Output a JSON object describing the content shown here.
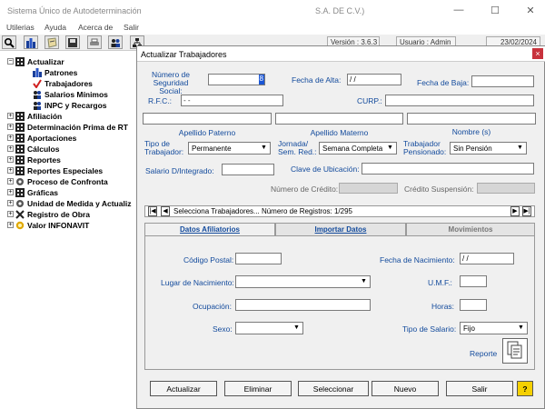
{
  "window": {
    "title": "Sistema Único de Autodeterminación",
    "title_suffix": "S.A. DE C.V.)",
    "minimize_glyph": "—",
    "maximize_glyph": "☐",
    "close_glyph": "✕"
  },
  "menu": [
    "Utilerias",
    "Ayuda",
    "Acerca de",
    "Salir"
  ],
  "status": {
    "version": "Versión : 3.6.3",
    "user": "Usuario : Admin",
    "date": "23/02/2024"
  },
  "toolbar_icons": [
    "search-icon",
    "buildings-icon",
    "document-icon",
    "save-icon",
    "printer-icon",
    "users-icon",
    "network-icon"
  ],
  "tree": [
    {
      "label": "Actualizar",
      "expander": "−",
      "level": 0
    },
    {
      "label": "Patrones",
      "level": 1
    },
    {
      "label": "Trabajadores",
      "level": 1
    },
    {
      "label": "Salarios Mínimos",
      "level": 1
    },
    {
      "label": "INPC y Recargos",
      "level": 1
    },
    {
      "label": "Afiliación",
      "expander": "+",
      "level": 0
    },
    {
      "label": "Determinación Prima de RT",
      "expander": "+",
      "level": 0
    },
    {
      "label": "Aportaciones",
      "expander": "+",
      "level": 0
    },
    {
      "label": "Cálculos",
      "expander": "+",
      "level": 0
    },
    {
      "label": "Reportes",
      "expander": "+",
      "level": 0
    },
    {
      "label": "Reportes Especiales",
      "expander": "+",
      "level": 0
    },
    {
      "label": "Proceso de Confronta",
      "expander": "+",
      "level": 0
    },
    {
      "label": "Gráficas",
      "expander": "+",
      "level": 0
    },
    {
      "label": "Unidad de Medida y Actualiz",
      "expander": "+",
      "level": 0
    },
    {
      "label": "Registro de Obra",
      "expander": "+",
      "level": 0
    },
    {
      "label": "Valor INFONAVIT",
      "expander": "+",
      "level": 0
    }
  ],
  "dialog": {
    "title": "Actualizar Trabajadores",
    "close_glyph": "×",
    "labels": {
      "nss_1": "Número de",
      "nss_2": "Seguridad Social:",
      "fecha_alta": "Fecha de Alta:",
      "fecha_baja": "Fecha de Baja:",
      "rfc": "R.F.C.:",
      "curp": "CURP.:",
      "apellido_paterno": "Apellido Paterno",
      "apellido_materno": "Apellido Materno",
      "nombres": "Nombre (s)",
      "tipo_trab_1": "Tipo de",
      "tipo_trab_2": "Trabajador:",
      "jornada_1": "Jornada/",
      "jornada_2": "Sem. Red.:",
      "pensionado_1": "Trabajador",
      "pensionado_2": "Pensionado:",
      "salario": "Salario D/Integrado:",
      "clave_ubicacion": "Clave de Ubicación:",
      "numero_credito": "Número de Crédito:",
      "credito_suspension": "Crédito Suspensión:"
    },
    "values": {
      "nss": "",
      "nss_digit": "8",
      "fecha_alta": " / /",
      "fecha_baja": "",
      "rfc": "    -      -",
      "curp": "",
      "apellido_paterno": "",
      "apellido_materno": "",
      "nombres": "",
      "tipo_trabajador": "Permanente",
      "jornada": "Semana Completa",
      "pensionado": "Sin Pensión",
      "salario": "",
      "clave_ubicacion": ""
    },
    "nav": {
      "text": "Selecciona Trabajadores... Número de Registros: 1/295",
      "first": "|◀",
      "prev": "◀",
      "next": "▶",
      "last": "▶|"
    },
    "tabs": [
      "Datos Afiliatorios",
      "Importar Datos",
      "Movimientos"
    ],
    "panel": {
      "codigo_postal": "Código Postal:",
      "fecha_nacimiento": "Fecha de Nacimiento:",
      "fecha_nacimiento_value": " / /",
      "lugar_nacimiento": "Lugar de Nacimiento:",
      "umf": "U.M.F.:",
      "ocupacion": "Ocupación:",
      "horas": "Horas:",
      "sexo": "Sexo:",
      "tipo_salario": "Tipo de Salario:",
      "tipo_salario_value": "Fijo",
      "reporte": "Reporte"
    },
    "buttons": [
      "Actualizar",
      "Eliminar",
      "Seleccionar",
      "Nuevo",
      "Salir"
    ],
    "help_glyph": "?"
  }
}
